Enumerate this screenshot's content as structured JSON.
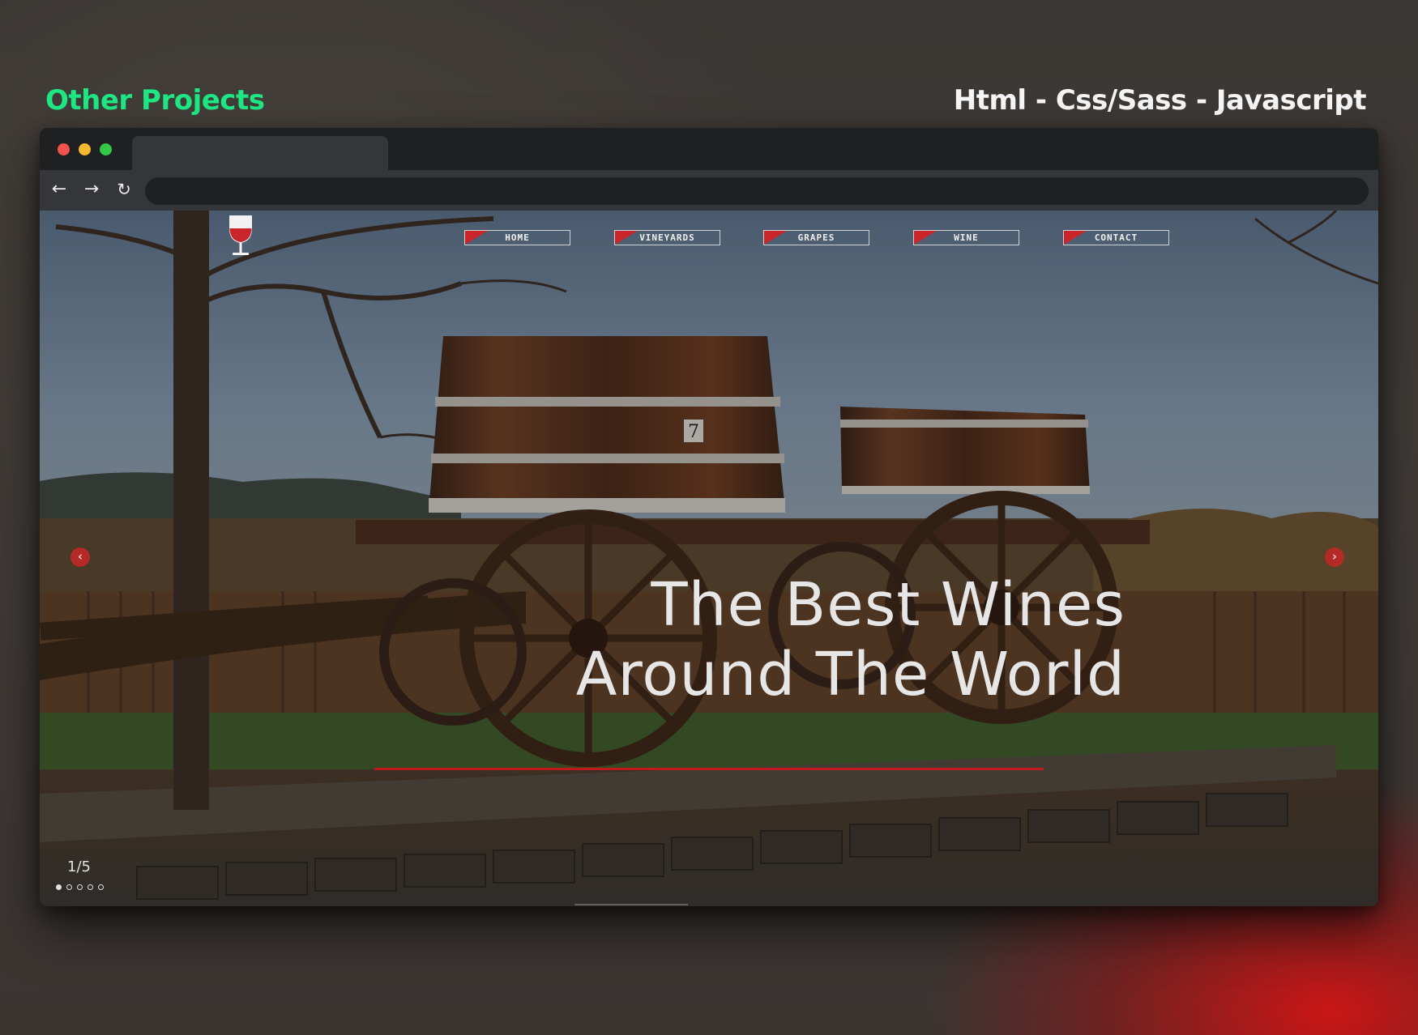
{
  "page": {
    "left_heading": "Other Projects",
    "right_heading": "Html - Css/Sass - Javascript"
  },
  "browser": {
    "buttons": {
      "back_icon": "arrow-left-icon",
      "forward_icon": "arrow-right-icon",
      "reload_icon": "reload-icon"
    },
    "address": ""
  },
  "site": {
    "logo_icon": "wine-glass-icon",
    "nav": [
      {
        "label": "HOME"
      },
      {
        "label": "VINEYARDS"
      },
      {
        "label": "GRAPES"
      },
      {
        "label": "WINE"
      },
      {
        "label": "CONTACT"
      }
    ],
    "hero": {
      "line1": "The Best Wines",
      "line2": "Around The World"
    },
    "slider": {
      "counter": "1/5",
      "total": 5,
      "current": 1,
      "prev_icon": "chevron-left-icon",
      "next_icon": "chevron-right-icon"
    }
  },
  "colors": {
    "accent_green": "#1ee884",
    "accent_red": "#c2191e",
    "nav_flag_red": "#c9252b"
  }
}
